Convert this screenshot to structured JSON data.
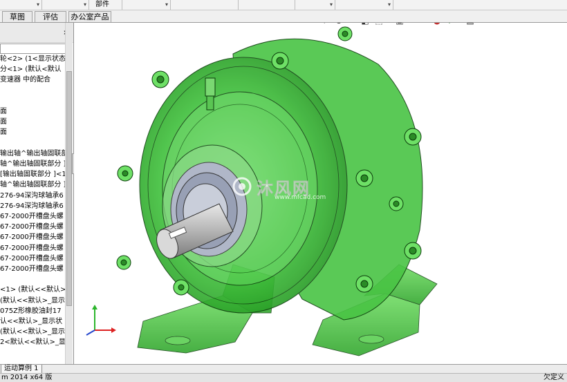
{
  "menubar": {
    "part_label": "部件"
  },
  "tabs": [
    {
      "label": "草图"
    },
    {
      "label": "评估"
    },
    {
      "label": "办公室产品"
    }
  ],
  "tree": [
    "轮<2> (1<显示状态",
    "分<1> (默认<默认",
    "变速器 中的配合",
    "",
    "",
    "面",
    "面",
    "面",
    "",
    "输出轴^输出轴固联部",
    "轴^输出轴固联部分 ]",
    "[输出轴固联部分 ]<1",
    "轴^输出轴固联部分 ]",
    "276-94深沟球轴承6",
    "276-94深沟球轴承6",
    "67-2000开槽盘头螺",
    "67-2000开槽盘头螺",
    "67-2000开槽盘头螺",
    "67-2000开槽盘头螺",
    "67-2000开槽盘头螺",
    "67-2000开槽盘头螺",
    "",
    "<1> (默认<<默认>_",
    "(默认<<默认>_显示",
    "075Z形橡胶油封17",
    "认<<默认>_显示状",
    "(默认<<默认>_显示",
    "2<默认<<默认>_显示"
  ],
  "bottom_tab": "运动算例 1",
  "status": {
    "left": "m 2014 x64 版",
    "right": "欠定义"
  },
  "watermark": {
    "text": "沐风网",
    "sub": "www.mfcad.com"
  },
  "colors": {
    "model_green": "#39c43a",
    "model_dark": "#0b3b0b",
    "shaft": "#b8b8b8",
    "bearing": "#9aa3b8"
  },
  "heads_up_icons": [
    "zoom-to-fit-icon",
    "zoom-area-icon",
    "previous-view-icon",
    "section-view-icon",
    "view-orientation-icon",
    "display-style-icon",
    "hide-show-icon",
    "edit-appearance-icon",
    "apply-scene-icon",
    "view-settings-icon"
  ]
}
